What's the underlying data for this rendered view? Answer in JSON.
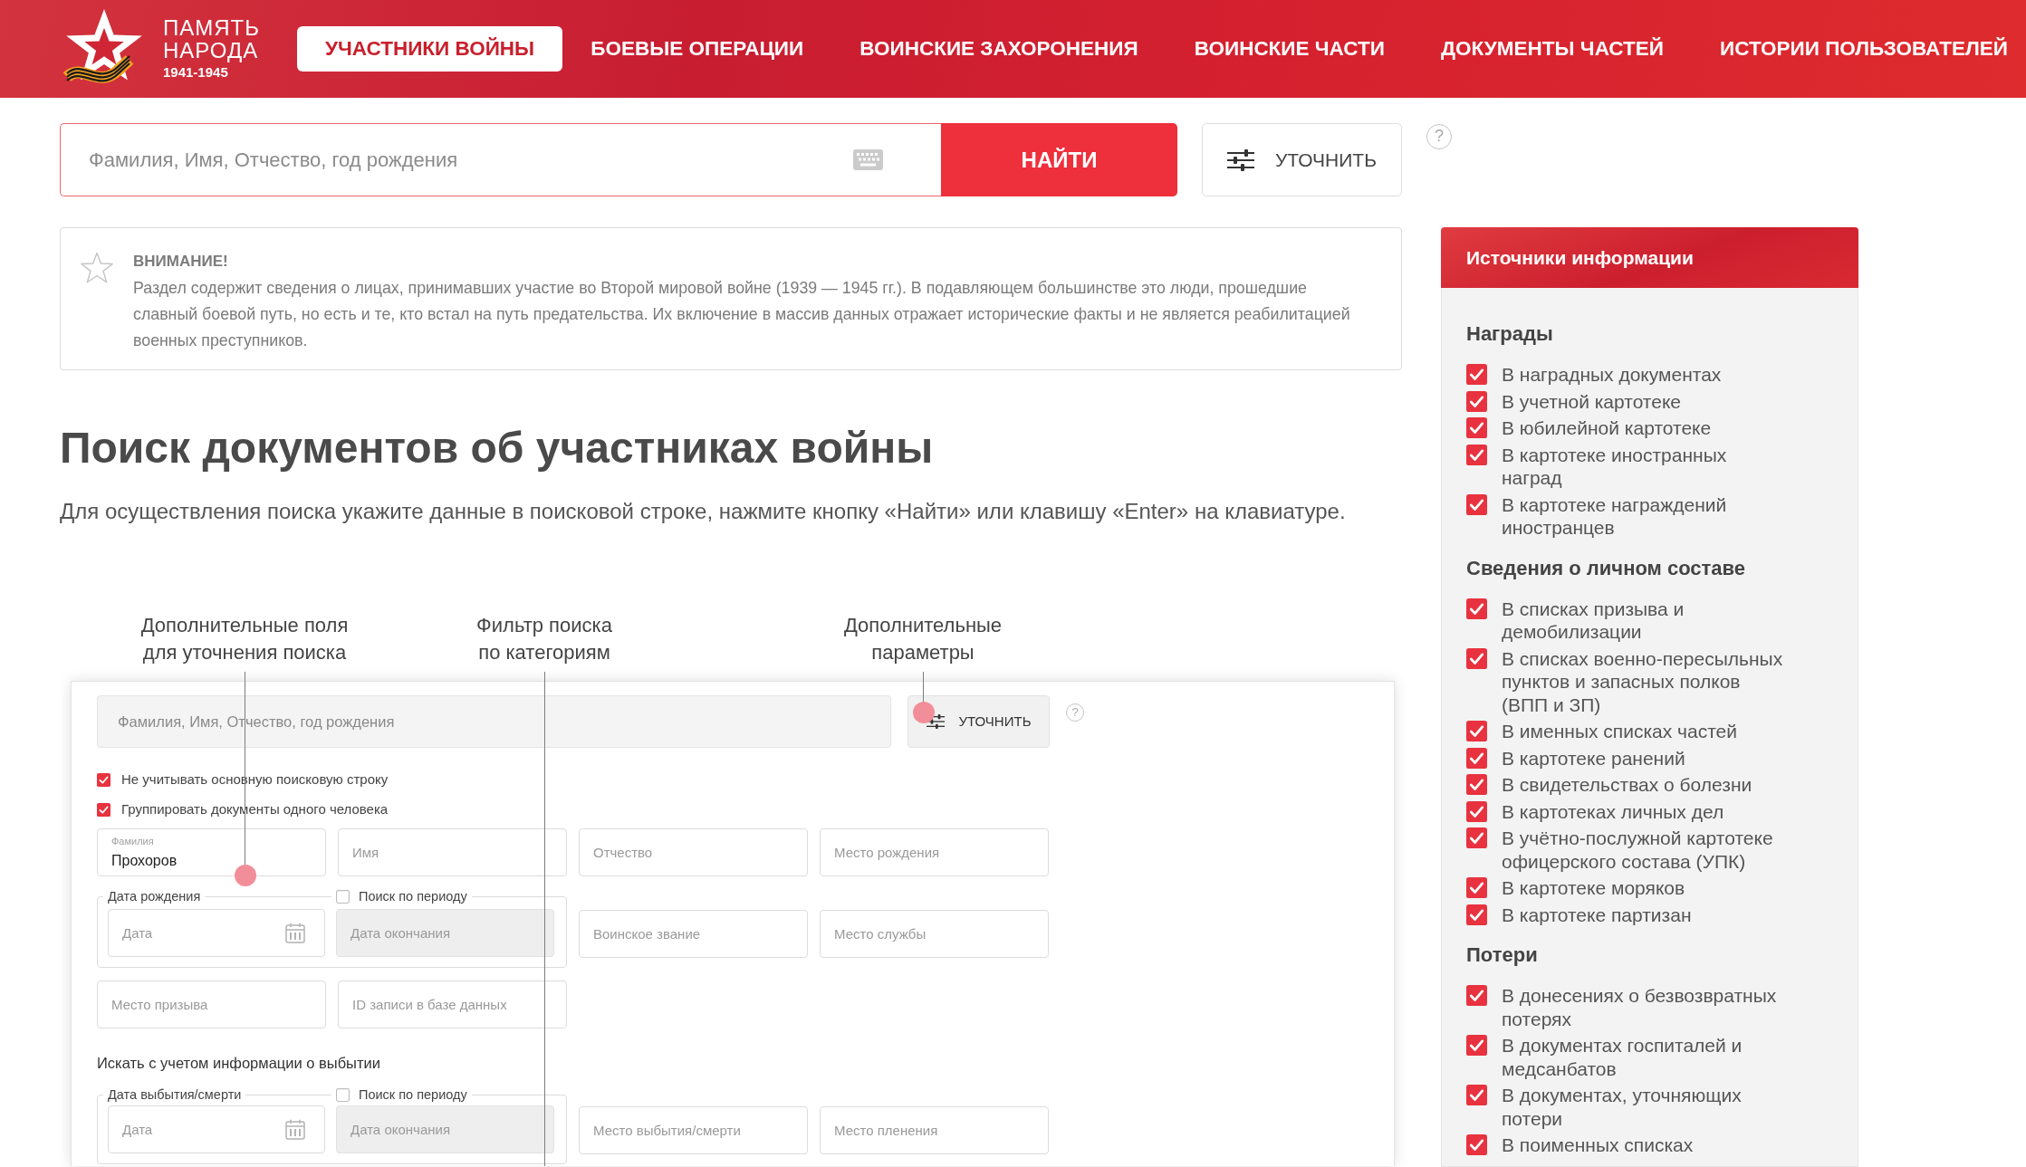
{
  "header": {
    "logo": {
      "title": "ПАМЯТЬ\nНАРОДА",
      "years": "1941-1945"
    },
    "nav": [
      {
        "label": "УЧАСТНИКИ ВОЙНЫ",
        "selected": true
      },
      {
        "label": "БОЕВЫЕ ОПЕРАЦИИ",
        "selected": false
      },
      {
        "label": "ВОИНСКИЕ ЗАХОРОНЕНИЯ",
        "selected": false
      },
      {
        "label": "ВОИНСКИЕ ЧАСТИ",
        "selected": false
      },
      {
        "label": "ДОКУМЕНТЫ ЧАСТЕЙ",
        "selected": false
      },
      {
        "label": "ИСТОРИИ ПОЛЬЗОВАТЕЛЕЙ",
        "selected": false
      }
    ]
  },
  "search": {
    "placeholder": "Фамилия, Имя, Отчество, год рождения",
    "submit": "НАЙТИ",
    "refine": "УТОЧНИТЬ",
    "help": "?"
  },
  "notice": {
    "title": "ВНИМАНИЕ!",
    "text": "Раздел содержит сведения о лицах, принимавших участие во Второй мировой войне (1939 — 1945 гг.). В подавляющем большинстве это люди, прошедшие славный боевой путь, но есть и те, кто встал на путь предательства. Их включение в массив данных отражает исторические факты и не является реабилитацией военных преступников."
  },
  "intro": {
    "heading": "Поиск документов об участниках войны",
    "text": "Для осуществления поиска укажите данные в поисковой строке, нажмите кнопку «Найти» или клавишу «Enter» на клавиатуре."
  },
  "illustration": {
    "callouts": [
      {
        "text": "Дополнительные поля\nдля уточнения поиска",
        "marker": true
      },
      {
        "text": "Фильтр поиска\nпо категориям",
        "marker": false
      },
      {
        "text": "Дополнительные\nпараметры",
        "marker": true
      }
    ],
    "form": {
      "query": {
        "placeholder": "Фамилия, Имя, Отчество, год рождения"
      },
      "refine": "УТОЧНИТЬ",
      "help": "?",
      "options": [
        {
          "label": "Не учитывать основную поисковую строку",
          "checked": true
        },
        {
          "label": "Группировать документы одного человека",
          "checked": true
        }
      ],
      "name_fields": [
        {
          "label": "Фамилия",
          "value": "Прохоров"
        },
        {
          "placeholder": "Имя"
        },
        {
          "placeholder": "Отчество"
        },
        {
          "placeholder": "Место рождения"
        }
      ],
      "birth_date": {
        "legend": "Дата рождения",
        "period": {
          "label": "Поиск по периоду",
          "checked": false
        },
        "start": {
          "placeholder": "Дата"
        },
        "end": {
          "placeholder": "Дата окончания"
        }
      },
      "service_fields": [
        {
          "placeholder": "Воинское звание"
        },
        {
          "placeholder": "Место службы"
        }
      ],
      "extra_fields": [
        {
          "placeholder": "Место призыва"
        },
        {
          "placeholder": "ID записи в базе данных"
        }
      ],
      "departure": {
        "heading": "Искать с учетом информации о выбытии",
        "date": {
          "legend": "Дата выбытия/смерти",
          "period": {
            "label": "Поиск по периоду",
            "checked": false
          },
          "start": {
            "placeholder": "Дата"
          },
          "end": {
            "placeholder": "Дата окончания"
          }
        },
        "fields": [
          {
            "placeholder": "Место выбытия/смерти"
          },
          {
            "placeholder": "Место пленения"
          }
        ]
      }
    }
  },
  "sources": {
    "title": "Источники информации",
    "groups": [
      {
        "heading": "Награды",
        "items": [
          {
            "label": "В наградных документах",
            "checked": true
          },
          {
            "label": "В учетной картотеке",
            "checked": true
          },
          {
            "label": "В юбилейной картотеке",
            "checked": true
          },
          {
            "label": "В картотеке иностранных\nнаград",
            "checked": true
          },
          {
            "label": "В картотеке награждений\nиностранцев",
            "checked": true
          }
        ]
      },
      {
        "heading": "Сведения о личном составе",
        "items": [
          {
            "label": "В списках призыва и\nдемобилизации",
            "checked": true
          },
          {
            "label": "В списках военно-пересыльных\nпунктов и запасных полков\n(ВПП и ЗП)",
            "checked": true
          },
          {
            "label": "В именных списках частей",
            "checked": true
          },
          {
            "label": "В картотеке ранений",
            "checked": true
          },
          {
            "label": "В свидетельствах о болезни",
            "checked": true
          },
          {
            "label": "В картотеках личных дел",
            "checked": true
          },
          {
            "label": "В учётно-послужной картотеке\nофицерского состава (УПК)",
            "checked": true
          },
          {
            "label": "В картотеке моряков",
            "checked": true
          },
          {
            "label": "В картотеке партизан",
            "checked": true
          }
        ]
      },
      {
        "heading": "Потери",
        "items": [
          {
            "label": "В донесениях о безвозвратных\nпотерях",
            "checked": true
          },
          {
            "label": "В документах госпиталей и\nмедсанбатов",
            "checked": true
          },
          {
            "label": "В документах, уточняющих\nпотери",
            "checked": true
          },
          {
            "label": "В поименных списках",
            "checked": true
          }
        ]
      }
    ]
  }
}
